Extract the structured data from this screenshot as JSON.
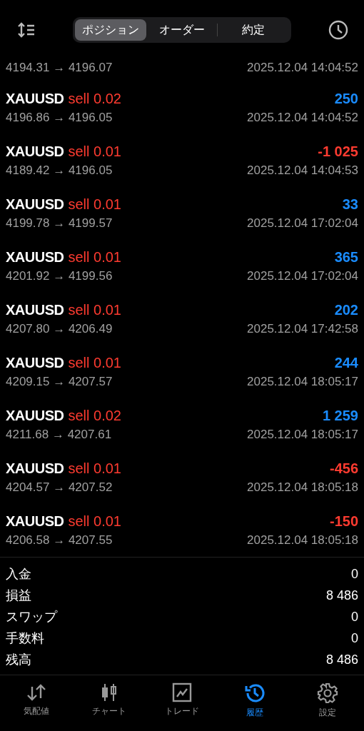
{
  "header": {
    "tabs": [
      {
        "label": "ポジション",
        "selected": true
      },
      {
        "label": "オーダー",
        "selected": false
      },
      {
        "label": "約定",
        "selected": false
      }
    ]
  },
  "cut_row": {
    "prices": "4194.31 → 4196.07",
    "time": "2025.12.04 14:04:52"
  },
  "deals": [
    {
      "symbol": "XAUUSD",
      "side": "sell 0.02",
      "profit": "250",
      "color": "#1a8cff",
      "prices": "4196.86 → 4196.05",
      "time": "2025.12.04 14:04:52"
    },
    {
      "symbol": "XAUUSD",
      "side": "sell 0.01",
      "profit": "-1 025",
      "color": "#ff3b30",
      "prices": "4189.42 → 4196.05",
      "time": "2025.12.04 14:04:53"
    },
    {
      "symbol": "XAUUSD",
      "side": "sell 0.01",
      "profit": "33",
      "color": "#1a8cff",
      "prices": "4199.78 → 4199.57",
      "time": "2025.12.04 17:02:04"
    },
    {
      "symbol": "XAUUSD",
      "side": "sell 0.01",
      "profit": "365",
      "color": "#1a8cff",
      "prices": "4201.92 → 4199.56",
      "time": "2025.12.04 17:02:04"
    },
    {
      "symbol": "XAUUSD",
      "side": "sell 0.01",
      "profit": "202",
      "color": "#1a8cff",
      "prices": "4207.80 → 4206.49",
      "time": "2025.12.04 17:42:58"
    },
    {
      "symbol": "XAUUSD",
      "side": "sell 0.01",
      "profit": "244",
      "color": "#1a8cff",
      "prices": "4209.15 → 4207.57",
      "time": "2025.12.04 18:05:17"
    },
    {
      "symbol": "XAUUSD",
      "side": "sell 0.02",
      "profit": "1 259",
      "color": "#1a8cff",
      "prices": "4211.68 → 4207.61",
      "time": "2025.12.04 18:05:17"
    },
    {
      "symbol": "XAUUSD",
      "side": "sell 0.01",
      "profit": "-456",
      "color": "#ff3b30",
      "prices": "4204.57 → 4207.52",
      "time": "2025.12.04 18:05:18"
    },
    {
      "symbol": "XAUUSD",
      "side": "sell 0.01",
      "profit": "-150",
      "color": "#ff3b30",
      "prices": "4206.58 → 4207.55",
      "time": "2025.12.04 18:05:18"
    }
  ],
  "summary": [
    {
      "label": "入金",
      "value": "0"
    },
    {
      "label": "損益",
      "value": "8 486"
    },
    {
      "label": "スワップ",
      "value": "0"
    },
    {
      "label": "手数料",
      "value": "0"
    },
    {
      "label": "残高",
      "value": "8 486"
    }
  ],
  "tab_bar": [
    {
      "label": "気配値",
      "selected": false
    },
    {
      "label": "チャート",
      "selected": false
    },
    {
      "label": "トレード",
      "selected": false
    },
    {
      "label": "履歴",
      "selected": true
    },
    {
      "label": "設定",
      "selected": false
    }
  ]
}
